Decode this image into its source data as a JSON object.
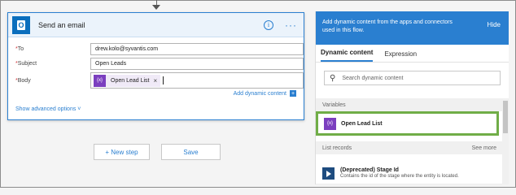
{
  "card": {
    "title": "Send an email",
    "icon": "outlook-icon",
    "info_icon": "info-icon",
    "more_icon": "ellipsis-icon",
    "fields": {
      "to": {
        "label": "To",
        "value": "drew.kolo@syvantis.com"
      },
      "subject": {
        "label": "Subject",
        "value": "Open Leads"
      },
      "body": {
        "label": "Body",
        "token": "Open Lead List",
        "token_icon": "{x}"
      }
    },
    "add_dynamic": "Add dynamic content",
    "show_advanced": "Show advanced options"
  },
  "buttons": {
    "new_step": "+ New step",
    "save": "Save"
  },
  "panel": {
    "header": "Add dynamic content from the apps and connectors used in this flow.",
    "hide": "Hide",
    "tabs": [
      "Dynamic content",
      "Expression"
    ],
    "search_placeholder": "Search dynamic content",
    "variables_head": "Variables",
    "variable_item": "Open Lead List",
    "list_records_head": "List records",
    "see_more": "See more",
    "record_title": "(Deprecated) Stage Id",
    "record_desc": "Contains the id of the stage where the entity is located."
  },
  "colors": {
    "accent": "#2a7fd0",
    "variable_token": "#7b3fbf",
    "highlight": "#70ad47"
  }
}
